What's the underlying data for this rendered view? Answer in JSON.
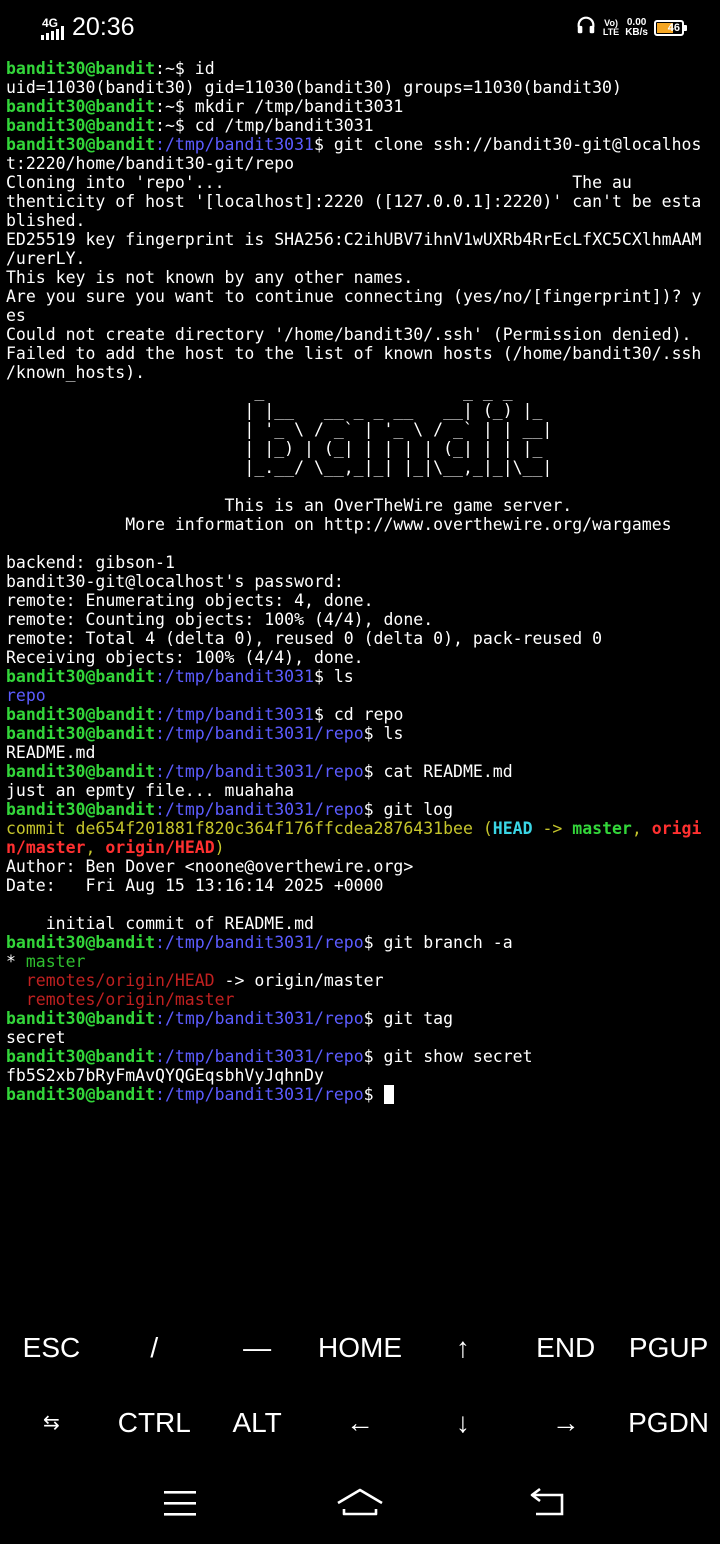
{
  "status_bar": {
    "network": "4G",
    "time": "20:36",
    "volte": "Vo) LTE",
    "volte_top": "Vo)",
    "volte_bottom": "LTE",
    "speed_value": "0.00",
    "speed_unit": "KB/s",
    "battery": "46",
    "icons": [
      "signal-icon",
      "headphones-icon",
      "battery-icon"
    ]
  },
  "terminal": {
    "prompt_user": "bandit30@bandit",
    "prompt_home": ":~",
    "lines": {
      "l1_cmd": "$ id",
      "l2": "uid=11030(bandit30) gid=11030(bandit30) groups=11030(bandit30)",
      "l3_cmd": "$ mkdir /tmp/bandit3031",
      "l4_cmd": "$ cd /tmp/bandit3031",
      "l5_path": ":/tmp/bandit3031",
      "l5_cmd": "$ git clone ssh://bandit30-git@localhos",
      "l6": "t:2220/home/bandit30-git/repo",
      "l7": "Cloning into 'repo'...                                   The au",
      "l8": "thenticity of host '[localhost]:2220 ([127.0.0.1]:2220)' can't be esta",
      "l9": "blished.",
      "l10": "ED25519 key fingerprint is SHA256:C2ihUBV7ihnV1wUXRb4RrEcLfXC5CXlhmAAM",
      "l11": "/urerLY.",
      "l12": "This key is not known by any other names.",
      "l13": "Are you sure you want to continue connecting (yes/no/[fingerprint])? y",
      "l14": "es",
      "l15": "Could not create directory '/home/bandit30/.ssh' (Permission denied).",
      "l16": "Failed to add the host to the list of known hosts (/home/bandit30/.ssh",
      "l17": "/known_hosts).",
      "ascii1": "                         _                    _ _ _",
      "ascii2": "                        | |__   __ _ _ __   __| (_) |_",
      "ascii3": "                        | '_ \\ / _` | '_ \\ / _` | | __|",
      "ascii4": "                        | |_) | (_| | | | | (_| | | |_",
      "ascii5": "                        |_.__/ \\__,_|_| |_|\\__,_|_|\\__|",
      "welcome1": "                      This is an OverTheWire game server.",
      "welcome2": "            More information on http://www.overthewire.org/wargames",
      "backend": "backend: gibson-1",
      "password": "bandit30-git@localhost's password:",
      "remote1": "remote: Enumerating objects: 4, done.",
      "remote2": "remote: Counting objects: 100% (4/4), done.",
      "remote3": "remote: Total 4 (delta 0), reused 0 (delta 0), pack-reused 0",
      "receiving": "Receiving objects: 100% (4/4), done.",
      "cmd_ls": "$ ls",
      "repo_dir": "repo",
      "cmd_cd_repo": "$ cd repo",
      "path_repo": ":/tmp/bandit3031/repo",
      "readme": "README.md",
      "cmd_cat": "$ cat README.md",
      "cat_out": "just an epmty file... muahaha",
      "cmd_log": "$ git log",
      "commit_hash": "commit de654f201881f820c364f176ffcdea2876431bee",
      "paren_open": " (",
      "head": "HEAD",
      "arrow": " -> ",
      "master": "master",
      "comma": ", ",
      "origi": "origi",
      "n_master": "n/master",
      "origin_head": "origin/HEAD",
      "paren_close": ")",
      "author": "Author: Ben Dover <noone@overthewire.org>",
      "date": "Date:   Fri Aug 15 13:16:14 2025 +0000",
      "commit_msg": "    initial commit of README.md",
      "cmd_branch": "$ git branch -a",
      "branch_star": "* ",
      "branch_master": "master",
      "remote_head": "  remotes/origin/HEAD",
      "remote_head_arrow": " -> origin/master",
      "remote_master": "  remotes/origin/master",
      "cmd_tag": "$ git tag",
      "tag_out": "secret",
      "cmd_show": "$ git show secret",
      "show_out": "fb5S2xb7bRyFmAvQYQGEqsbhVyJqhnDy",
      "final_prompt": "$ "
    }
  },
  "extra_keys": {
    "row1": [
      "ESC",
      "/",
      "—",
      "HOME",
      "↑",
      "END",
      "PGUP"
    ],
    "row2": [
      "⇆",
      "CTRL",
      "ALT",
      "←",
      "↓",
      "→",
      "PGDN"
    ]
  },
  "nav_bar": {
    "icons": [
      "menu-icon",
      "home-icon",
      "back-icon"
    ]
  }
}
